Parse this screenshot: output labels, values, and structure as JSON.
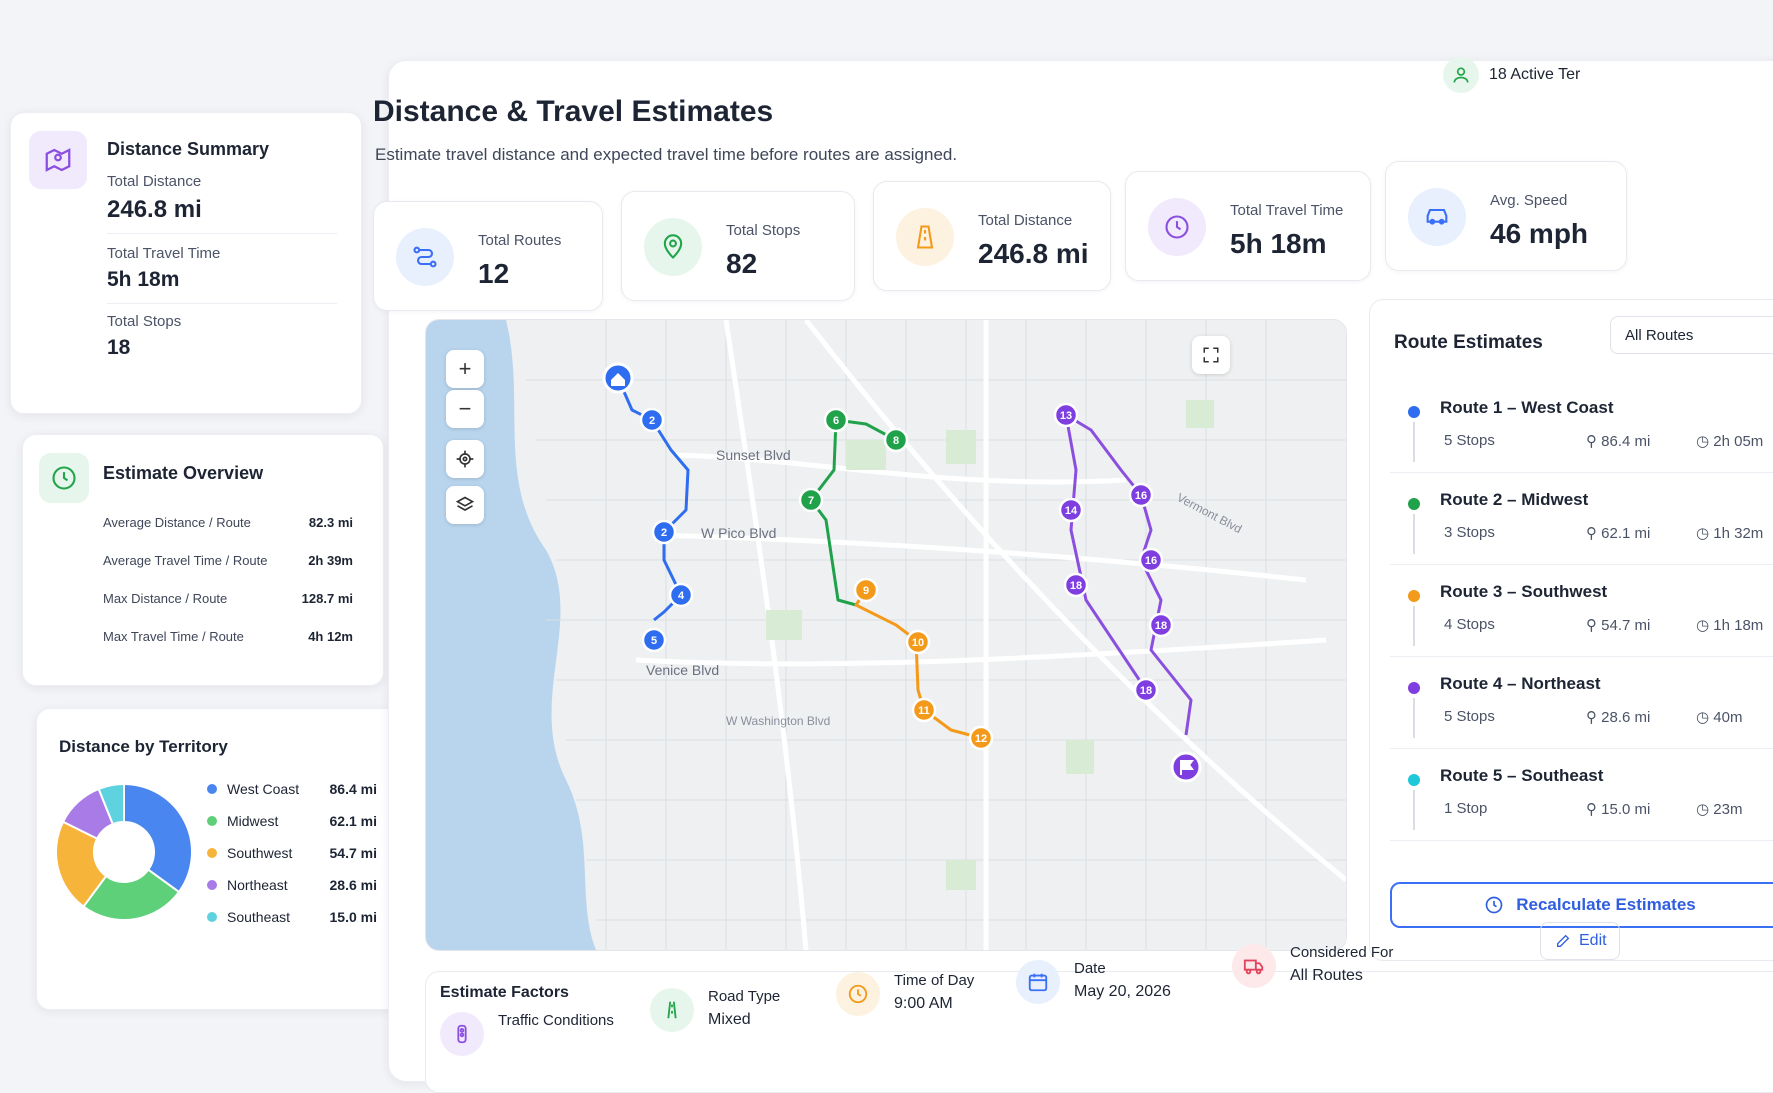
{
  "header": {
    "title": "Distance & Travel Estimates",
    "subtitle": "Estimate travel distance and expected travel time before routes are assigned.",
    "active_teams": "18 Active Ter"
  },
  "kpis": [
    {
      "label": "Total Routes",
      "value": "12",
      "color": "#3b6ff5"
    },
    {
      "label": "Total Stops",
      "value": "82",
      "color": "#22a54a"
    },
    {
      "label": "Total Distance",
      "value": "246.8 mi",
      "color": "#f39c1a"
    },
    {
      "label": "Total Travel Time",
      "value": "5h 18m",
      "color": "#8b4fe0"
    },
    {
      "label": "Avg. Speed",
      "value": "46 mph",
      "color": "#3b6ff5"
    }
  ],
  "summary": {
    "title": "Distance Summary",
    "items": [
      {
        "label": "Total Distance",
        "value": "246.8 mi"
      },
      {
        "label": "Total Travel Time",
        "value": "5h 18m"
      },
      {
        "label": "Total Stops",
        "value": "18"
      }
    ]
  },
  "overview": {
    "title": "Estimate Overview",
    "rows": [
      {
        "label": "Average Distance / Route",
        "value": "82.3 mi"
      },
      {
        "label": "Average Travel Time / Route",
        "value": "2h 39m"
      },
      {
        "label": "Max Distance / Route",
        "value": "128.7 mi"
      },
      {
        "label": "Max Travel Time / Route",
        "value": "4h 12m"
      }
    ]
  },
  "chart_data": {
    "type": "pie",
    "title": "Distance by Territory",
    "categories": [
      "West Coast",
      "Midwest",
      "Southwest",
      "Northeast",
      "Southeast"
    ],
    "values": [
      86.4,
      62.1,
      54.7,
      28.6,
      15.0
    ],
    "value_labels": [
      "86.4 mi",
      "62.1 mi",
      "54.7 mi",
      "28.6 mi",
      "15.0 mi"
    ],
    "colors": [
      "#4a86f0",
      "#5fd07a",
      "#f7b43a",
      "#a87be6",
      "#5fd2e0"
    ],
    "donut": true
  },
  "map": {
    "streets": [
      "Sunset Blvd",
      "W Pico Blvd",
      "Venice Blvd",
      "W Washington Blvd",
      "Vermont Blvd"
    ],
    "zoom_in": "+",
    "zoom_out": "−"
  },
  "estimates": {
    "title": "Route Estimates",
    "filter": "All Routes",
    "routes": [
      {
        "name": "Route 1 – West Coast",
        "stops": "5  Stops",
        "distance": "86.4 mi",
        "time": "2h 05m",
        "color": "#2f6df0"
      },
      {
        "name": "Route 2 – Midwest",
        "stops": "3  Stops",
        "distance": "62.1 mi",
        "time": "1h 32m",
        "color": "#1fa24a"
      },
      {
        "name": "Route 3 – Southwest",
        "stops": "4  Stops",
        "distance": "54.7 mi",
        "time": "1h 18m",
        "color": "#f39a1a"
      },
      {
        "name": "Route 4 – Northeast",
        "stops": "5  Stops",
        "distance": "28.6 mi",
        "time": "40m",
        "color": "#7f3fe0"
      },
      {
        "name": "Route 5 – Southeast",
        "stops": "1  Stop",
        "distance": "15.0 mi",
        "time": "23m",
        "color": "#1ec8d8"
      }
    ],
    "recalc": "Recalculate Estimates"
  },
  "factors": {
    "title": "Estimate Factors",
    "items": [
      {
        "label": "Traffic Conditions",
        "value": ""
      },
      {
        "label": "Road Type",
        "value": "Mixed"
      },
      {
        "label": "Time of Day",
        "value": "9:00 AM"
      },
      {
        "label": "Date",
        "value": "May 20, 2026"
      },
      {
        "label": "Considered For",
        "value": "All Routes"
      }
    ],
    "edit": "Edit"
  },
  "stops": [
    {
      "label": "2",
      "color": "#2f6df0"
    },
    {
      "label": "2",
      "color": "#2f6df0"
    },
    {
      "label": "4",
      "color": "#2f6df0"
    },
    {
      "label": "5",
      "color": "#2f6df0"
    },
    {
      "label": "6",
      "color": "#1fa24a"
    },
    {
      "label": "8",
      "color": "#1fa24a"
    },
    {
      "label": "7",
      "color": "#1fa24a"
    },
    {
      "label": "9",
      "color": "#f39a1a"
    },
    {
      "label": "10",
      "color": "#f39a1a"
    },
    {
      "label": "11",
      "color": "#f39a1a"
    },
    {
      "label": "12",
      "color": "#f39a1a"
    },
    {
      "label": "13",
      "color": "#7f3fe0"
    },
    {
      "label": "14",
      "color": "#7f3fe0"
    },
    {
      "label": "16",
      "color": "#7f3fe0"
    },
    {
      "label": "16",
      "color": "#7f3fe0"
    },
    {
      "label": "18",
      "color": "#7f3fe0"
    },
    {
      "label": "18",
      "color": "#7f3fe0"
    },
    {
      "label": "18",
      "color": "#7f3fe0"
    }
  ]
}
